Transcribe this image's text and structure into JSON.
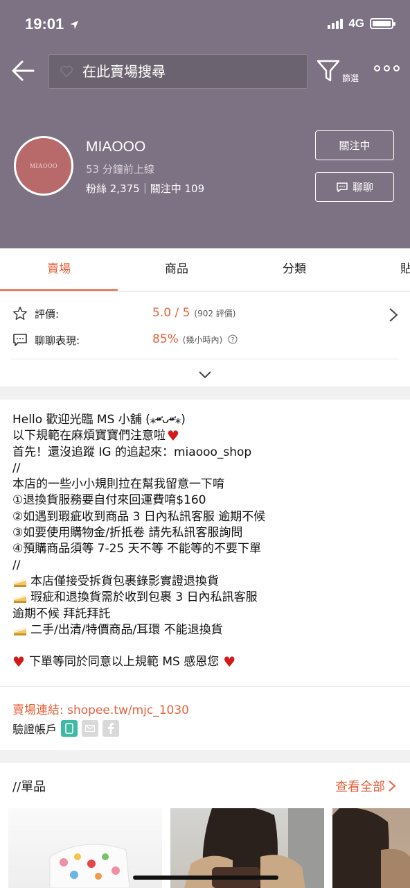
{
  "status_bar": {
    "time": "19:01",
    "network": "4G"
  },
  "header": {
    "search_placeholder": "在此賣場搜尋",
    "filter_label": "篩選"
  },
  "shop": {
    "avatar_text": "MIAOOO",
    "name": "MIAOOO",
    "online_status": "53 分鐘前上線",
    "stats": "粉絲 2,375｜關注中 109",
    "follow_label": "關注中",
    "chat_label": "聊聊"
  },
  "tabs": [
    {
      "label": "賣場",
      "active": true
    },
    {
      "label": "商品",
      "active": false
    },
    {
      "label": "分類",
      "active": false
    },
    {
      "label": "貼文",
      "active": false
    }
  ],
  "ratings": {
    "rating_label": "評價:",
    "rating_value": "5.0 / 5",
    "rating_count": "(902 評價)",
    "chat_label": "聊聊表現:",
    "chat_value": "85%",
    "chat_sub": "(幾小時內)"
  },
  "description": {
    "lines": [
      "Hello 歡迎光臨 MS 小舖 (⁎⁍̴̛ᴗ⁍̴̛⁎)",
      "以下規範在麻煩寶寶們注意啦",
      "首先！還沒追蹤 IG 的追起來：miaooo_shop",
      "//",
      "本店的一些小小規則拉在幫我留意一下唷",
      "①退換貨服務要自付來回運費唷$160",
      "②如遇到瑕疵收到商品 3 日內私訊客服 逾期不候",
      "③如要使用購物金/折抵卷 請先私訊客服詢問",
      "④預購商品須等 7-25 天不等 不能等的不要下單",
      "//",
      "本店僅接受拆貨包裹錄影實證退換貨",
      "瑕疵和退換貨需於收到包裹 3 日內私訊客服",
      "逾期不候 拜託拜託",
      "二手/出清/特價商品/耳環 不能退換貨",
      "",
      "下單等同於同意以上規範 MS 感恩您"
    ],
    "shop_link": "賣場連結: shopee.tw/mjc_1030",
    "verify_label": "驗證帳戶"
  },
  "products": {
    "title": "//單品",
    "see_all": "查看全部"
  },
  "colors": {
    "accent": "#e4623c",
    "header_bg": "#7c7283"
  }
}
